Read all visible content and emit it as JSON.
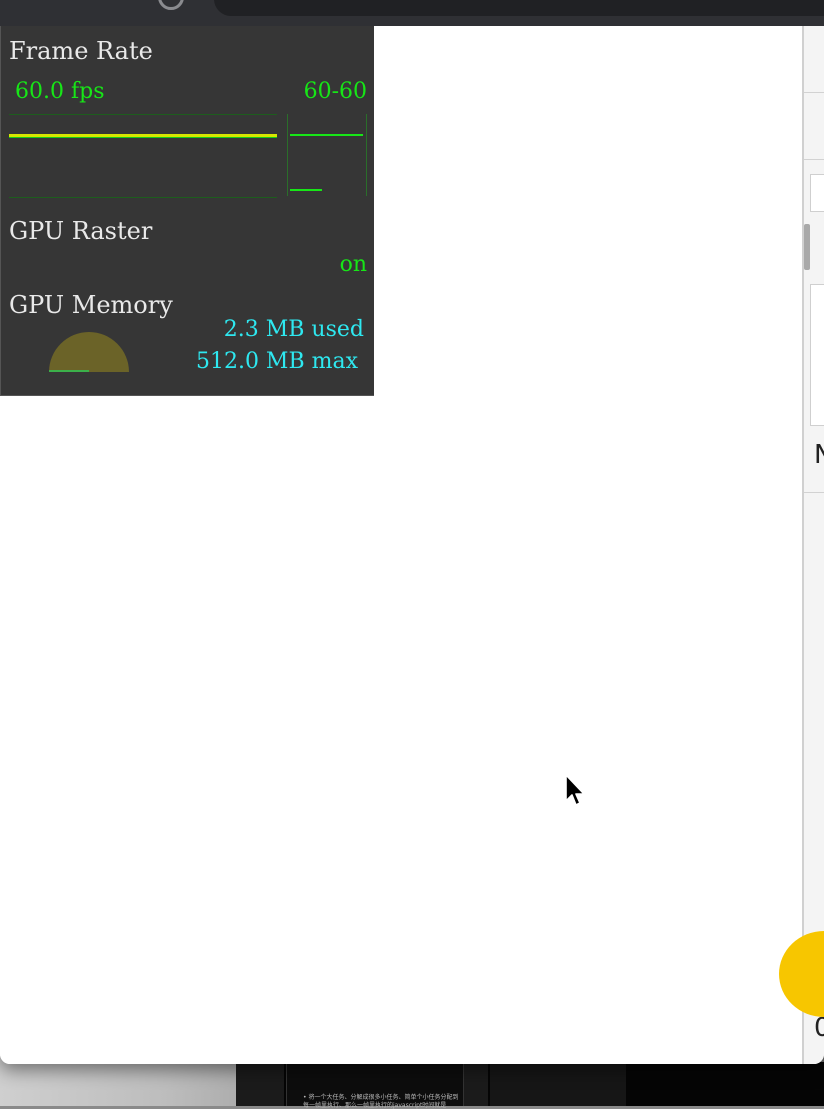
{
  "hud": {
    "frame_rate": {
      "title": "Frame Rate",
      "fps": "60.0 fps",
      "range": "60-60"
    },
    "gpu_raster": {
      "title": "GPU Raster",
      "status": "on"
    },
    "gpu_memory": {
      "title": "GPU Memory",
      "used": "2.3 MB used",
      "max": "512.0 MB max"
    }
  },
  "right_panel": {
    "row_glyph_1": "N",
    "row_glyph_2": "0"
  },
  "taskbar": {
    "thumb_line_1": "• 将一个大任务、分解成很多小任务、简单个小任务分配到",
    "thumb_line_2": "每一帧里执行、那么一帧里执行的javascript时间就是"
  },
  "colors": {
    "hud_background": "#363636",
    "hud_green": "#17e617",
    "hud_cyan": "#2ee8f0",
    "fab_yellow": "#f7c600"
  },
  "icons": [
    "reload-icon",
    "info-icon",
    "mouse-cursor-icon"
  ]
}
